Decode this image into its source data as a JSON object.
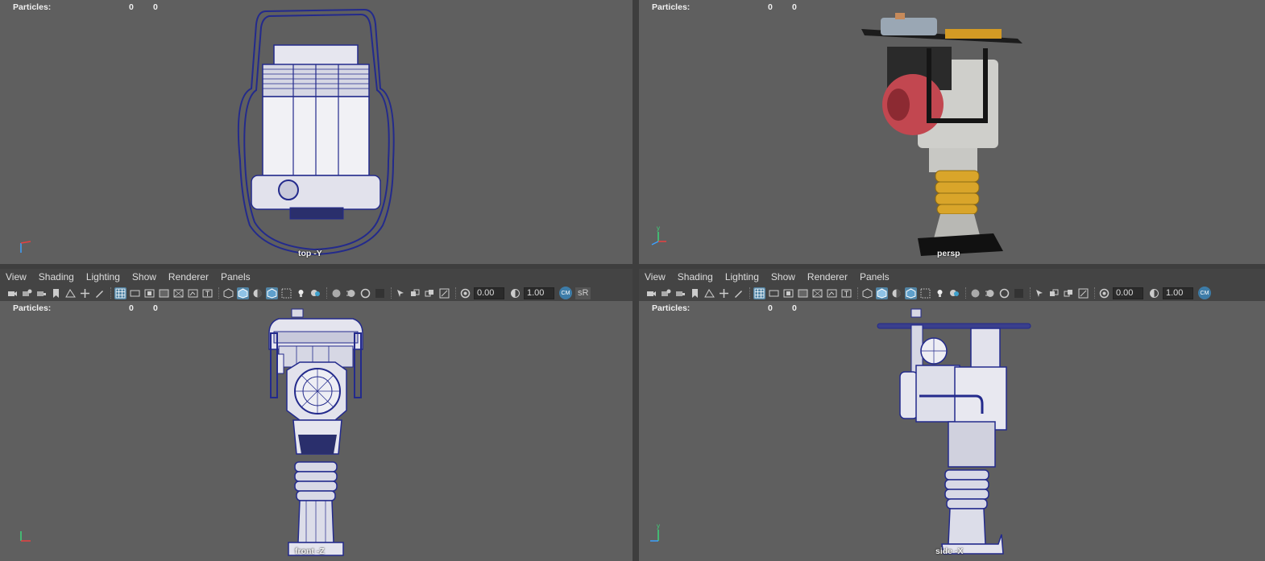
{
  "hud": {
    "label": "Particles:",
    "value_a": "0",
    "value_b": "0"
  },
  "viewports": {
    "top": {
      "camera": "top -Y"
    },
    "persp": {
      "camera": "persp"
    },
    "front": {
      "camera": "front -Z"
    },
    "side": {
      "camera": "side -X"
    }
  },
  "axis_labels": {
    "x": "x",
    "y": "y",
    "z": "z"
  },
  "panel_menu": [
    "View",
    "Shading",
    "Lighting",
    "Show",
    "Renderer",
    "Panels"
  ],
  "toolbar": {
    "camera_icons": [
      "camera-select-icon",
      "camera-attributes-icon",
      "bookmark-icon",
      "image-plane-icon",
      "2d-pan-zoom-icon",
      "grease-pencil-icon"
    ],
    "display_icons": [
      "grid-icon",
      "film-gate-icon",
      "resolution-gate-icon",
      "gate-mask-icon",
      "field-chart-icon",
      "safe-action-icon",
      "safe-title-icon"
    ],
    "shading_icons": [
      "wireframe-icon",
      "smooth-shade-icon",
      "default-material-icon",
      "wireframe-on-shaded-icon",
      "xray-icon",
      "use-lights-icon",
      "shadows-icon"
    ],
    "exposure_value": "0.00",
    "gamma_value": "1.00",
    "colorspace_label": "sR"
  },
  "colors": {
    "viewport_bg": "#5f5f5f",
    "wire": "#232a8c",
    "panel_bg": "#444444",
    "accent": "#5285a6",
    "engine_red": "#c9404a",
    "spring_yellow": "#d9a52a"
  }
}
